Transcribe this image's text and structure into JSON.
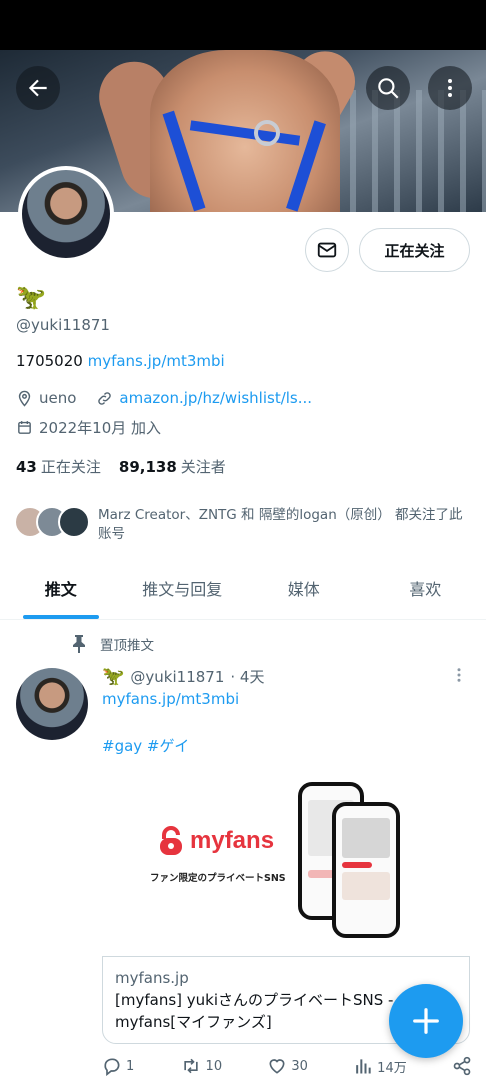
{
  "profile": {
    "display_emoji": "🦖",
    "handle": "@yuki11871",
    "bio_prefix": "1705020 ",
    "bio_link": "myfans.jp/mt3mbi",
    "location": "ueno",
    "website": "amazon.jp/hz/wishlist/ls...",
    "joined": "2022年10月 加入",
    "following_count": "43",
    "following_label": "正在关注",
    "followers_count": "89,138",
    "followers_label": "关注者",
    "known_followers": "Marz Creator、ZNTG 和 隔壁的logan（原创） 都关注了此账号",
    "follow_button": "正在关注"
  },
  "tabs": [
    {
      "label": "推文"
    },
    {
      "label": "推文与回复"
    },
    {
      "label": "媒体"
    },
    {
      "label": "喜欢"
    }
  ],
  "tweet": {
    "pinned_label": "置顶推文",
    "emoji": "🦖",
    "handle": "@yuki11871",
    "time": "· 4天",
    "link": "myfans.jp/mt3mbi",
    "hashtags": "#gay #ゲイ",
    "media_brand": "myfans",
    "media_tagline": "ファン限定のプライベートSNS",
    "card_domain": "myfans.jp",
    "card_title": "[myfans] yukiさんのプライベートSNS - myfans[マイファンズ]",
    "replies": "1",
    "retweets": "10",
    "likes": "30",
    "views": "14万"
  },
  "colors": {
    "accent": "#1d9bf0",
    "text": "#0f1419",
    "secondary": "#536471",
    "myfans_red": "#e6343e"
  },
  "icons": {
    "back": "arrow-left-icon",
    "search": "search-icon",
    "more": "more-vertical-icon",
    "message": "mail-icon",
    "location": "location-pin-icon",
    "link": "link-icon",
    "calendar": "calendar-icon",
    "pin": "pin-icon",
    "reply": "reply-icon",
    "retweet": "retweet-icon",
    "like": "heart-icon",
    "views": "bar-chart-icon",
    "share": "share-icon",
    "compose": "plus-icon"
  }
}
